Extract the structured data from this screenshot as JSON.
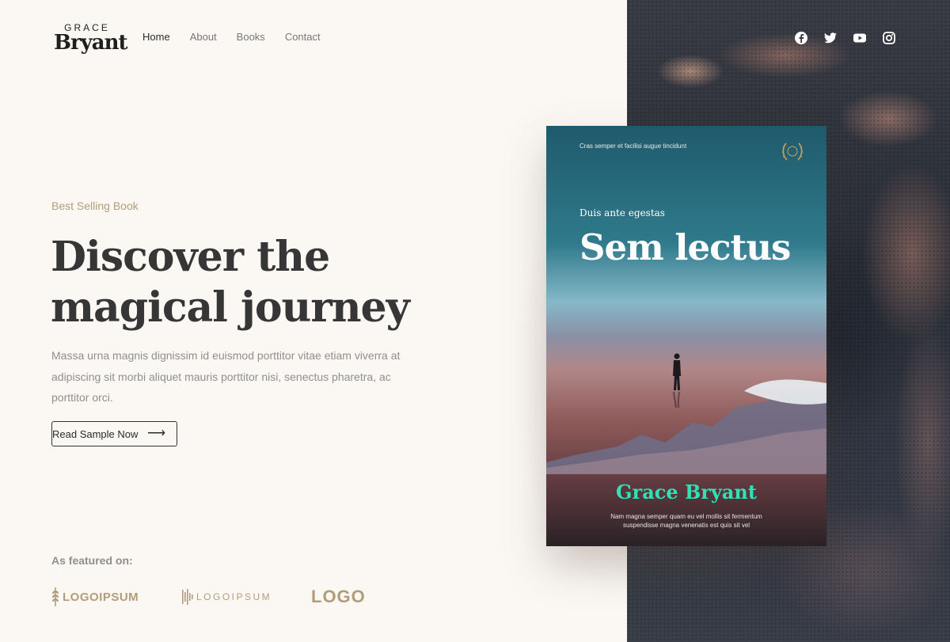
{
  "brand": {
    "logo_top": "GRACE",
    "logo_bottom": "Bryant"
  },
  "nav": {
    "items": [
      {
        "label": "Home",
        "active": true
      },
      {
        "label": "About",
        "active": false
      },
      {
        "label": "Books",
        "active": false
      },
      {
        "label": "Contact",
        "active": false
      }
    ]
  },
  "social": [
    "facebook-icon",
    "twitter-icon",
    "youtube-icon",
    "instagram-icon"
  ],
  "hero": {
    "eyebrow": "Best Selling Book",
    "headline_line1": "Discover the",
    "headline_line2": "magical journey",
    "description": "Massa urna magnis dignissim id euismod porttitor vitae etiam viverra at adipiscing sit morbi aliquet mauris porttitor nisi, senectus pharetra, ac porttitor orci.",
    "cta_label": "Read Sample Now",
    "cta_arrow": "⟶"
  },
  "featured": {
    "label": "As featured on:",
    "logos": [
      "LOGOIPSUM",
      "LOGOIPSUM",
      "LOGO"
    ]
  },
  "book": {
    "tagline": "Cras semper et facilisi augue tincidunt",
    "subtitle": "Duis ante egestas",
    "title": "Sem lectus",
    "author": "Grace Bryant",
    "blurb_line1": "Nam magna semper quam eu vel mollis sit fermentum",
    "blurb_line2": "suspendisse magna venenatis est quis sit vel"
  },
  "colors": {
    "accent": "#b39c7b",
    "heading": "#363636",
    "author": "#2fe2b6",
    "background": "#fbf8f4"
  }
}
